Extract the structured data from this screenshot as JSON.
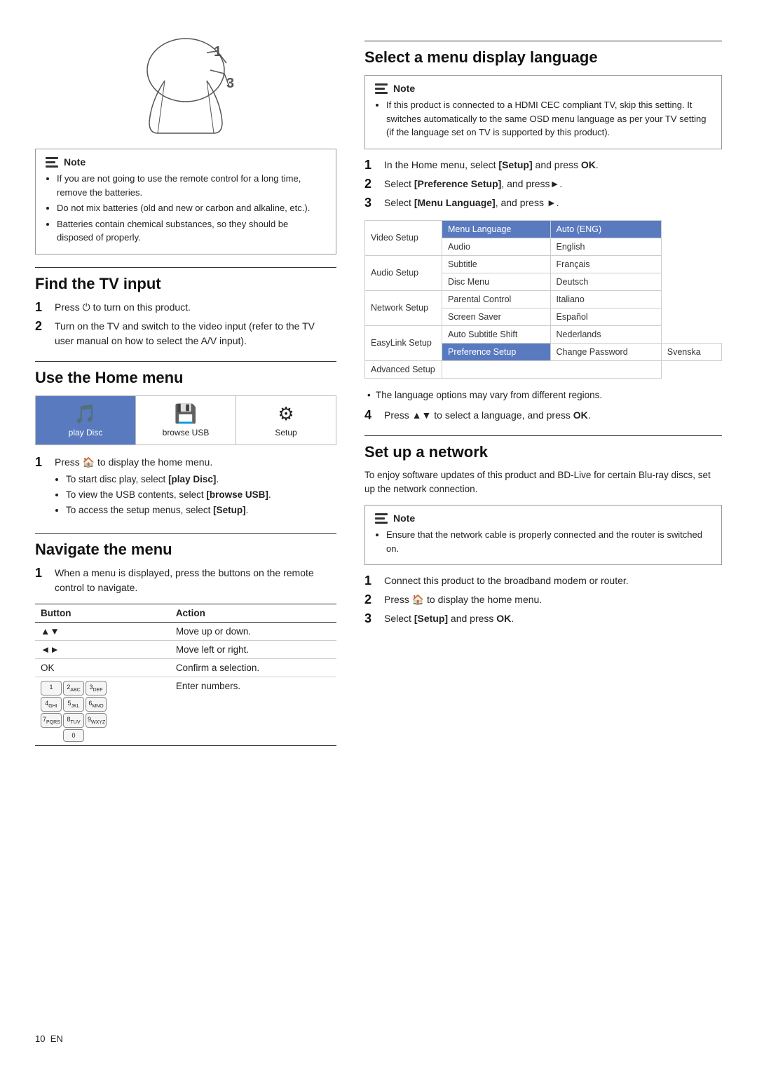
{
  "page": {
    "number": "10",
    "lang": "EN"
  },
  "left": {
    "remote_note": {
      "header": "Note",
      "bullets": [
        "If you are not going to use the remote control for a long time, remove the batteries.",
        "Do not mix batteries (old and new or carbon and alkaline, etc.).",
        "Batteries contain chemical substances, so they should be disposed of properly."
      ]
    },
    "find_tv": {
      "title": "Find the TV input",
      "steps": [
        {
          "num": "1",
          "text": "Press ⏻ to turn on this product."
        },
        {
          "num": "2",
          "text": "Turn on the TV and switch to the video input (refer to the TV user manual on how to select the A/V input)."
        }
      ]
    },
    "home_menu": {
      "title": "Use the Home menu",
      "items": [
        {
          "label": "play Disc",
          "icon": "🎵",
          "selected": true
        },
        {
          "label": "browse USB",
          "icon": "💾",
          "selected": false
        },
        {
          "label": "Setup",
          "icon": "⚙",
          "selected": false
        }
      ],
      "steps": [
        {
          "num": "1",
          "text": "Press 🏠 to display the home menu.",
          "sub": [
            "To start disc play, select [play Disc].",
            "To view the USB contents, select [browse USB].",
            "To access the setup menus, select [Setup]."
          ]
        }
      ]
    },
    "navigate": {
      "title": "Navigate the menu",
      "steps": [
        {
          "num": "1",
          "text": "When a menu is displayed, press the buttons on the remote control to navigate."
        }
      ],
      "table": {
        "col1": "Button",
        "col2": "Action",
        "rows": [
          {
            "button": "▲▼",
            "action": "Move up or down."
          },
          {
            "button": "◄►",
            "action": "Move left or right."
          },
          {
            "button": "OK",
            "action": "Confirm a selection."
          },
          {
            "button": "numpad",
            "action": "Enter numbers."
          }
        ]
      }
    }
  },
  "right": {
    "select_language": {
      "title": "Select a menu display language",
      "note": {
        "header": "Note",
        "bullets": [
          "If this product is connected to a HDMI CEC compliant TV, skip this setting. It switches automatically to the same OSD menu language as per your TV setting (if the language set on TV is supported by this product)."
        ]
      },
      "steps": [
        {
          "num": "1",
          "text": "In the Home menu, select [Setup] and press OK."
        },
        {
          "num": "2",
          "text": "Select [Preference Setup], and press►."
        },
        {
          "num": "3",
          "text": "Select [Menu Language], and press ►."
        }
      ],
      "table": {
        "setup_items": [
          "Video Setup",
          "Audio Setup",
          "Network Setup",
          "EasyLink Setup",
          "Preference Setup",
          "Advanced Setup"
        ],
        "menu_items": [
          "Menu Language",
          "Audio",
          "Subtitle",
          "Disc Menu",
          "Parental Control",
          "Screen Saver",
          "Auto Subtitle Shift",
          "Change Password"
        ],
        "lang_items": [
          {
            "value": "Auto (ENG)",
            "highlighted": true
          },
          {
            "value": "English"
          },
          {
            "value": "Français"
          },
          {
            "value": "Deutsch"
          },
          {
            "value": "Italiano"
          },
          {
            "value": "Español"
          },
          {
            "value": "Nederlands"
          },
          {
            "value": "Svenska"
          }
        ],
        "selected_setup": "Preference Setup"
      },
      "bullet": "The language options may vary from different regions.",
      "step4": {
        "num": "4",
        "text": "Press ▲▼ to select a language, and press OK."
      }
    },
    "network": {
      "title": "Set up a network",
      "intro": "To enjoy software updates of this product and BD-Live for certain Blu-ray discs, set up the network connection.",
      "note": {
        "header": "Note",
        "bullets": [
          "Ensure that the network cable is properly connected and the router is switched on."
        ]
      },
      "steps": [
        {
          "num": "1",
          "text": "Connect this product to the broadband modem or router."
        },
        {
          "num": "2",
          "text": "Press 🏠 to display the home menu."
        },
        {
          "num": "3",
          "text": "Select [Setup] and press OK."
        }
      ]
    }
  }
}
